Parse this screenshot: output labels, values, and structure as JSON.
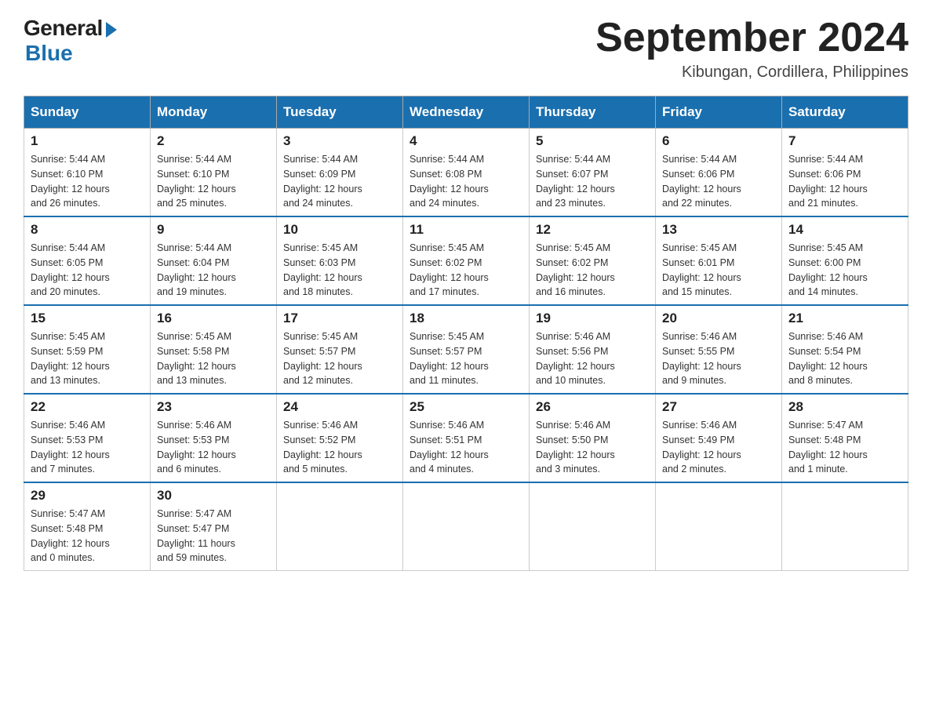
{
  "logo": {
    "general": "General",
    "blue": "Blue"
  },
  "header": {
    "month_year": "September 2024",
    "location": "Kibungan, Cordillera, Philippines"
  },
  "weekdays": [
    "Sunday",
    "Monday",
    "Tuesday",
    "Wednesday",
    "Thursday",
    "Friday",
    "Saturday"
  ],
  "weeks": [
    [
      {
        "day": "1",
        "sunrise": "5:44 AM",
        "sunset": "6:10 PM",
        "daylight": "12 hours and 26 minutes."
      },
      {
        "day": "2",
        "sunrise": "5:44 AM",
        "sunset": "6:10 PM",
        "daylight": "12 hours and 25 minutes."
      },
      {
        "day": "3",
        "sunrise": "5:44 AM",
        "sunset": "6:09 PM",
        "daylight": "12 hours and 24 minutes."
      },
      {
        "day": "4",
        "sunrise": "5:44 AM",
        "sunset": "6:08 PM",
        "daylight": "12 hours and 24 minutes."
      },
      {
        "day": "5",
        "sunrise": "5:44 AM",
        "sunset": "6:07 PM",
        "daylight": "12 hours and 23 minutes."
      },
      {
        "day": "6",
        "sunrise": "5:44 AM",
        "sunset": "6:06 PM",
        "daylight": "12 hours and 22 minutes."
      },
      {
        "day": "7",
        "sunrise": "5:44 AM",
        "sunset": "6:06 PM",
        "daylight": "12 hours and 21 minutes."
      }
    ],
    [
      {
        "day": "8",
        "sunrise": "5:44 AM",
        "sunset": "6:05 PM",
        "daylight": "12 hours and 20 minutes."
      },
      {
        "day": "9",
        "sunrise": "5:44 AM",
        "sunset": "6:04 PM",
        "daylight": "12 hours and 19 minutes."
      },
      {
        "day": "10",
        "sunrise": "5:45 AM",
        "sunset": "6:03 PM",
        "daylight": "12 hours and 18 minutes."
      },
      {
        "day": "11",
        "sunrise": "5:45 AM",
        "sunset": "6:02 PM",
        "daylight": "12 hours and 17 minutes."
      },
      {
        "day": "12",
        "sunrise": "5:45 AM",
        "sunset": "6:02 PM",
        "daylight": "12 hours and 16 minutes."
      },
      {
        "day": "13",
        "sunrise": "5:45 AM",
        "sunset": "6:01 PM",
        "daylight": "12 hours and 15 minutes."
      },
      {
        "day": "14",
        "sunrise": "5:45 AM",
        "sunset": "6:00 PM",
        "daylight": "12 hours and 14 minutes."
      }
    ],
    [
      {
        "day": "15",
        "sunrise": "5:45 AM",
        "sunset": "5:59 PM",
        "daylight": "12 hours and 13 minutes."
      },
      {
        "day": "16",
        "sunrise": "5:45 AM",
        "sunset": "5:58 PM",
        "daylight": "12 hours and 13 minutes."
      },
      {
        "day": "17",
        "sunrise": "5:45 AM",
        "sunset": "5:57 PM",
        "daylight": "12 hours and 12 minutes."
      },
      {
        "day": "18",
        "sunrise": "5:45 AM",
        "sunset": "5:57 PM",
        "daylight": "12 hours and 11 minutes."
      },
      {
        "day": "19",
        "sunrise": "5:46 AM",
        "sunset": "5:56 PM",
        "daylight": "12 hours and 10 minutes."
      },
      {
        "day": "20",
        "sunrise": "5:46 AM",
        "sunset": "5:55 PM",
        "daylight": "12 hours and 9 minutes."
      },
      {
        "day": "21",
        "sunrise": "5:46 AM",
        "sunset": "5:54 PM",
        "daylight": "12 hours and 8 minutes."
      }
    ],
    [
      {
        "day": "22",
        "sunrise": "5:46 AM",
        "sunset": "5:53 PM",
        "daylight": "12 hours and 7 minutes."
      },
      {
        "day": "23",
        "sunrise": "5:46 AM",
        "sunset": "5:53 PM",
        "daylight": "12 hours and 6 minutes."
      },
      {
        "day": "24",
        "sunrise": "5:46 AM",
        "sunset": "5:52 PM",
        "daylight": "12 hours and 5 minutes."
      },
      {
        "day": "25",
        "sunrise": "5:46 AM",
        "sunset": "5:51 PM",
        "daylight": "12 hours and 4 minutes."
      },
      {
        "day": "26",
        "sunrise": "5:46 AM",
        "sunset": "5:50 PM",
        "daylight": "12 hours and 3 minutes."
      },
      {
        "day": "27",
        "sunrise": "5:46 AM",
        "sunset": "5:49 PM",
        "daylight": "12 hours and 2 minutes."
      },
      {
        "day": "28",
        "sunrise": "5:47 AM",
        "sunset": "5:48 PM",
        "daylight": "12 hours and 1 minute."
      }
    ],
    [
      {
        "day": "29",
        "sunrise": "5:47 AM",
        "sunset": "5:48 PM",
        "daylight": "12 hours and 0 minutes."
      },
      {
        "day": "30",
        "sunrise": "5:47 AM",
        "sunset": "5:47 PM",
        "daylight": "11 hours and 59 minutes."
      },
      null,
      null,
      null,
      null,
      null
    ]
  ]
}
